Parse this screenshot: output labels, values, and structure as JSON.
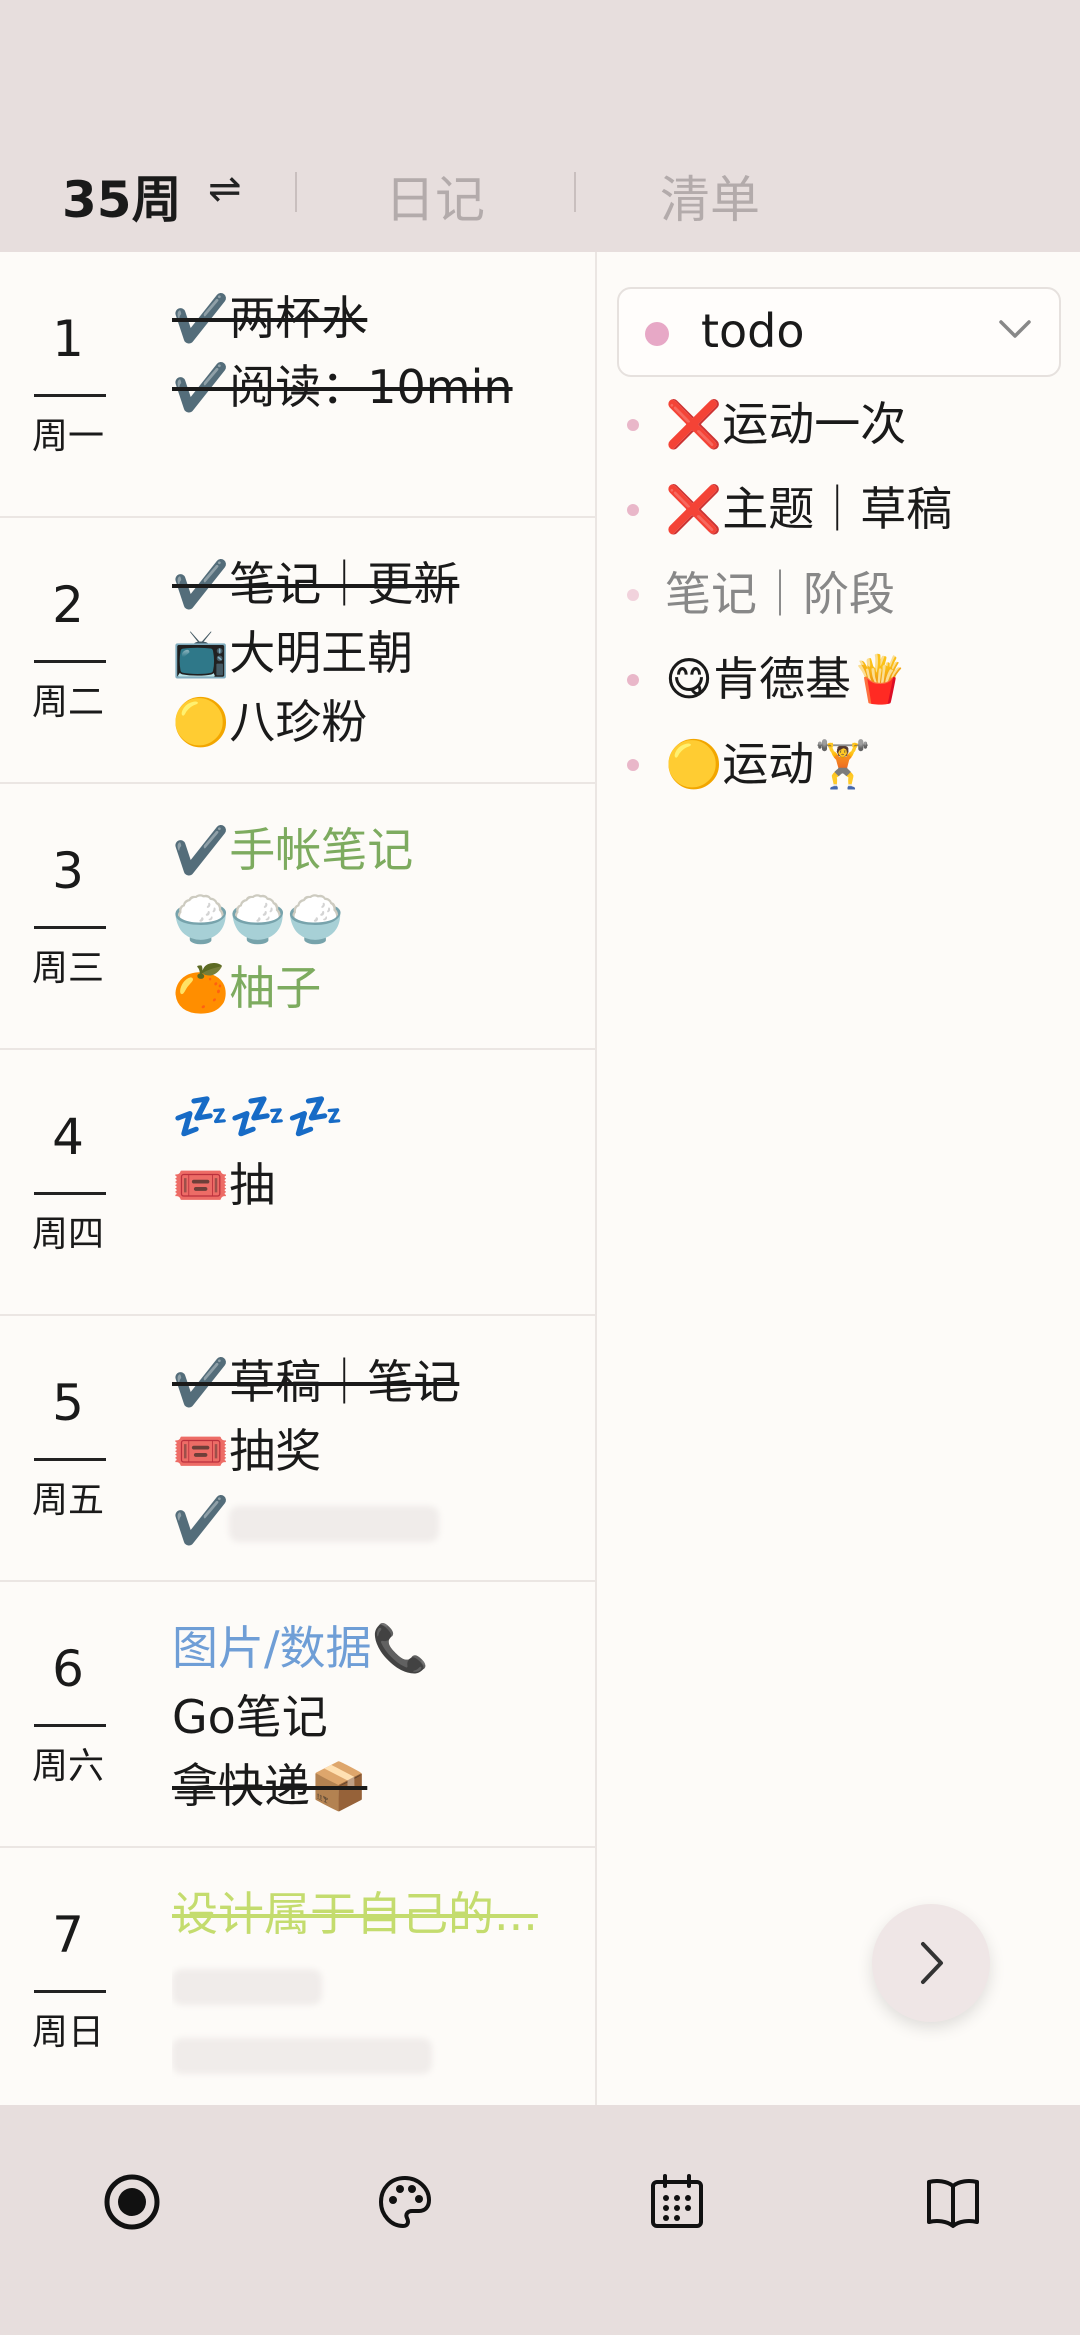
{
  "header": {
    "week_tab": "35周",
    "swap_icon": "⇌",
    "diary_tab": "日记",
    "list_tab": "清单"
  },
  "days": [
    {
      "num": "1",
      "name": "周一",
      "items": [
        {
          "text": "✔️两杯水",
          "style": "strike"
        },
        {
          "text": "✔️阅读：10min",
          "style": "strike"
        }
      ]
    },
    {
      "num": "2",
      "name": "周二",
      "items": [
        {
          "text": "✔️笔记｜更新",
          "style": "strike"
        },
        {
          "text": "📺大明王朝",
          "style": ""
        },
        {
          "text": "🟡八珍粉",
          "style": ""
        }
      ]
    },
    {
      "num": "3",
      "name": "周三",
      "items": [
        {
          "text": "✔️手帐笔记",
          "style": "green"
        },
        {
          "text": "🍚🍚🍚",
          "style": ""
        },
        {
          "text": "🍊柚子",
          "style": "green"
        }
      ]
    },
    {
      "num": "4",
      "name": "周四",
      "items": [
        {
          "text": "💤💤💤",
          "style": ""
        },
        {
          "text": "🎟️抽",
          "style": ""
        }
      ]
    },
    {
      "num": "5",
      "name": "周五",
      "items": [
        {
          "text": "✔️草稿｜笔记",
          "style": "strike"
        },
        {
          "text": "🎟️抽奖",
          "style": ""
        },
        {
          "text": "✔️",
          "style": "blurred"
        }
      ]
    },
    {
      "num": "6",
      "name": "周六",
      "items": [
        {
          "text": "图片/数据📞",
          "style": "blue"
        },
        {
          "text": "Go笔记",
          "style": ""
        },
        {
          "text": "拿快递📦",
          "style": "strike"
        }
      ]
    },
    {
      "num": "7",
      "name": "周日",
      "items": [
        {
          "text": "设计属于自己的...",
          "style": "lime-strike"
        },
        {
          "text": "",
          "style": "blurred"
        },
        {
          "text": "",
          "style": "blurred"
        }
      ]
    }
  ],
  "todo": {
    "select_label": "todo",
    "dot_color": "#e7a8c6",
    "items": [
      {
        "text": "❌运动一次",
        "style": ""
      },
      {
        "text": "❌主题｜草稿",
        "style": ""
      },
      {
        "text": "笔记｜阶段",
        "style": "muted"
      },
      {
        "text": "😋肯德基🍟",
        "style": ""
      },
      {
        "text": "🟡运动🏋️",
        "style": ""
      }
    ]
  },
  "nav": {
    "icons": [
      "record-icon",
      "palette-icon",
      "calendar-icon",
      "book-icon"
    ]
  },
  "colors": {
    "background": "#e7dedd",
    "content": "#fdfbf8",
    "green": "#7dab5f",
    "blue": "#6f9ed6",
    "lime": "#c4dc6e"
  }
}
